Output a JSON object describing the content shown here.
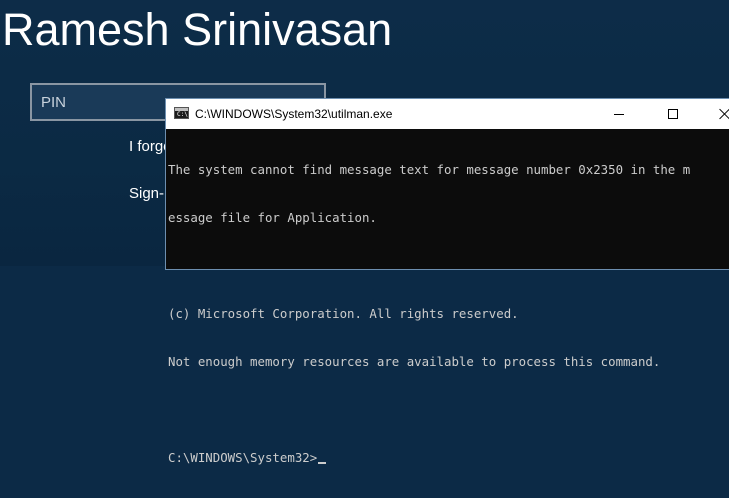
{
  "lock_screen": {
    "user_name": "Ramesh Srinivasan",
    "pin_placeholder": "PIN",
    "forgot_link": "I forgot my PIN",
    "signin_options_link": "Sign-in options"
  },
  "console_window": {
    "title": "C:\\WINDOWS\\System32\\utilman.exe",
    "icon": "console-app-icon",
    "lines": [
      "The system cannot find message text for message number 0x2350 in the m",
      "essage file for Application.",
      "",
      "(c) Microsoft Corporation. All rights reserved.",
      "Not enough memory resources are available to process this command.",
      "",
      "C:\\WINDOWS\\System32>"
    ]
  },
  "colors": {
    "lock_background": "#0c2a46",
    "console_background": "#0c0c0c",
    "console_text": "#cccccc",
    "titlebar": "#ffffff"
  }
}
